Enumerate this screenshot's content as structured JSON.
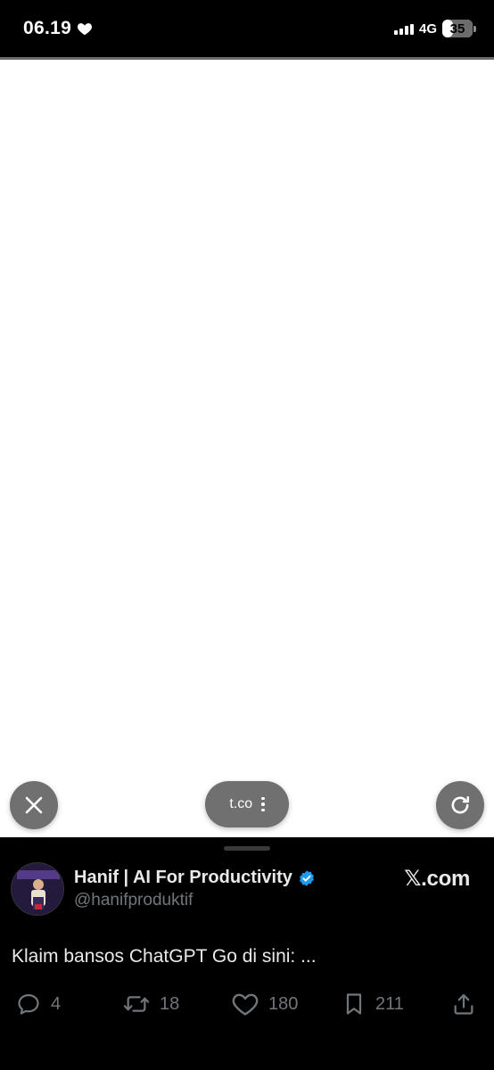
{
  "status_bar": {
    "time": "06.19",
    "network": "4G",
    "battery": "35",
    "battery_level": 0.35,
    "time_icon": "heart-icon"
  },
  "browser": {
    "url_domain": "t.co",
    "close_icon": "close-icon",
    "menu_icon": "more-vertical-icon",
    "reload_icon": "reload-icon"
  },
  "tweet": {
    "author_name": "Hanif | AI For Productivity",
    "handle": "@hanifproduktif",
    "verified_icon": "verified-badge-icon",
    "site": "𝕏.com",
    "text": "Klaim bansos ChatGPT Go di sini: ...",
    "replies": "4",
    "reposts": "18",
    "likes": "180",
    "bookmarks": "211"
  },
  "colors": {
    "background": "#000000",
    "text": "#e7e9ea",
    "muted": "#71767b",
    "verified": "#1d9bf0",
    "overlay_button": "#707070"
  }
}
